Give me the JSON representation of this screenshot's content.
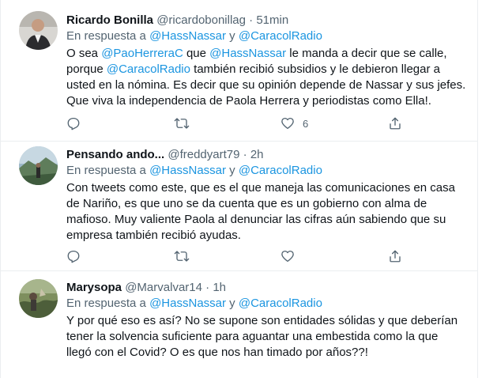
{
  "reply_prefix": "En respuesta a",
  "reply_and": "y",
  "tweets": [
    {
      "name": "Ricardo Bonilla",
      "handle": "@ricardobonillag",
      "separator": "·",
      "time": "51min",
      "reply_to": [
        "@HassNassar",
        "@CaracolRadio"
      ],
      "text_parts": [
        {
          "t": "O sea "
        },
        {
          "t": "@PaoHerreraC",
          "link": true
        },
        {
          "t": " que "
        },
        {
          "t": "@HassNassar",
          "link": true
        },
        {
          "t": " le manda a decir que se calle, porque "
        },
        {
          "t": "@CaracolRadio",
          "link": true
        },
        {
          "t": " también recibió subsidios y le debieron llegar a usted en la nómina. Es decir que su opinión depende de Nassar y sus jefes. Que viva la independencia de Paola Herrera y periodistas como Ella!."
        }
      ],
      "likes": "6"
    },
    {
      "name": "Pensando ando...",
      "handle": "@freddyart79",
      "separator": "·",
      "time": "2h",
      "reply_to": [
        "@HassNassar",
        "@CaracolRadio"
      ],
      "text_parts": [
        {
          "t": "Con tweets como este, que es el que maneja las comunicaciones en casa de Nariño, es que uno se da cuenta que es un gobierno con alma de mafioso. Muy valiente Paola al denunciar las cifras aún sabiendo que su empresa también recibió ayudas."
        }
      ],
      "likes": ""
    },
    {
      "name": "Marysopa",
      "handle": "@Marvalvar14",
      "separator": "·",
      "time": "1h",
      "reply_to": [
        "@HassNassar",
        "@CaracolRadio"
      ],
      "text_parts": [
        {
          "t": "Y por qué eso es así? No se supone son entidades sólidas y que deberían tener la solvencia suficiente para aguantar una embestida como la que llegó con el Covid? O es que nos han timado por años??!"
        }
      ],
      "likes": ""
    }
  ]
}
